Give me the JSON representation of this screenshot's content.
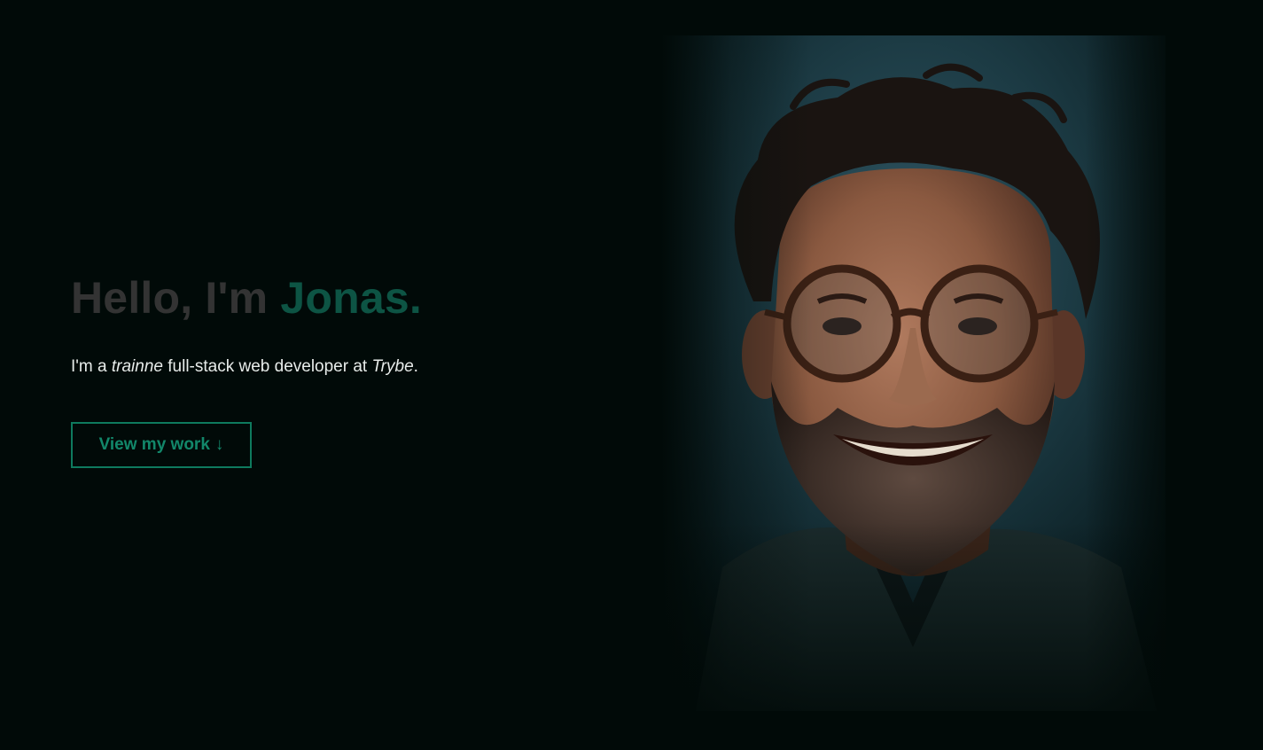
{
  "hero": {
    "greeting": "Hello, I'm ",
    "name": "Jonas.",
    "tagline_prefix": "I'm a ",
    "tagline_emphasis": "trainne",
    "tagline_middle": " full-stack web developer at ",
    "tagline_company": "Trybe",
    "tagline_suffix": ".",
    "cta_label": "View my work",
    "cta_icon": "arrow-down-icon",
    "cta_arrow": "↓"
  },
  "portrait": {
    "alt": "Portrait of a smiling man with curly dark hair, round tortoiseshell glasses and a short graying beard",
    "icon": "portrait-photo"
  },
  "colors": {
    "background": "#010a08",
    "headline_gray": "#333333",
    "accent_green": "#0d5444",
    "button_green": "#12876a",
    "text_light": "#e8ecea"
  }
}
